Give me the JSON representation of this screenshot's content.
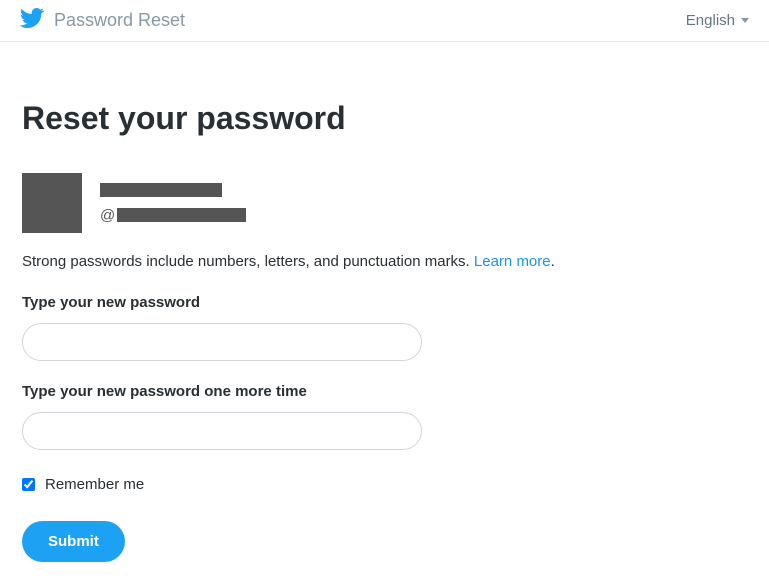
{
  "header": {
    "title": "Password Reset",
    "language": "English"
  },
  "main": {
    "heading": "Reset your password",
    "user": {
      "handle_prefix": "@"
    },
    "hint_text": "Strong passwords include numbers, letters, and punctuation marks. ",
    "learn_more_label": "Learn more",
    "hint_period": ".",
    "field1_label": "Type your new password",
    "field2_label": "Type your new password one more time",
    "field1_value": "",
    "field2_value": "",
    "remember_checked": true,
    "remember_label": "Remember me",
    "submit_label": "Submit"
  }
}
